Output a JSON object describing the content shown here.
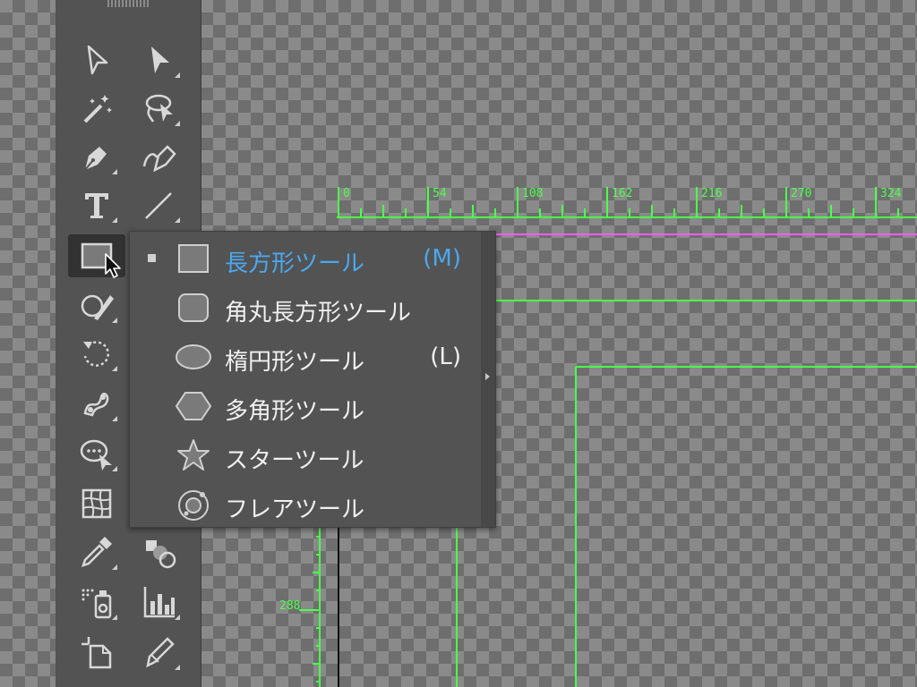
{
  "toolbar": {
    "tools": [
      {
        "name": "selection-tool",
        "icon": "selection-arrow-icon"
      },
      {
        "name": "direct-selection-tool",
        "icon": "direct-selection-arrow-icon"
      },
      {
        "name": "magic-wand-tool",
        "icon": "magic-wand-icon"
      },
      {
        "name": "lasso-tool",
        "icon": "lasso-icon"
      },
      {
        "name": "pen-tool",
        "icon": "pen-icon"
      },
      {
        "name": "curvature-tool",
        "icon": "curvature-pen-icon"
      },
      {
        "name": "type-tool",
        "icon": "type-icon",
        "glyph": "T"
      },
      {
        "name": "line-segment-tool",
        "icon": "line-segment-icon"
      },
      {
        "name": "rectangle-tool",
        "icon": "rectangle-icon",
        "active": true
      },
      {
        "name": "shaper-tool",
        "icon": "shaper-icon"
      },
      {
        "name": "rotate-tool",
        "icon": "rotate-icon"
      },
      {
        "name": "puppet-warp-tool",
        "icon": "puppet-warp-icon"
      },
      {
        "name": "free-transform-tool",
        "icon": "free-transform-icon"
      },
      {
        "name": "perspective-grid-tool",
        "icon": "perspective-grid-icon"
      },
      {
        "name": "eyedropper-tool",
        "icon": "eyedropper-icon"
      },
      {
        "name": "blend-tool",
        "icon": "blend-icon"
      },
      {
        "name": "symbol-sprayer-tool",
        "icon": "symbol-sprayer-icon"
      },
      {
        "name": "column-graph-tool",
        "icon": "column-graph-icon"
      },
      {
        "name": "artboard-tool",
        "icon": "artboard-icon"
      },
      {
        "name": "slice-tool",
        "icon": "slice-knife-icon"
      }
    ]
  },
  "flyout": {
    "items": [
      {
        "label": "長方形ツール",
        "shortcut": "(M)",
        "icon": "rectangle-icon",
        "selected": true
      },
      {
        "label": "角丸長方形ツール",
        "shortcut": "",
        "icon": "rounded-rectangle-icon",
        "selected": false
      },
      {
        "label": "楕円形ツール",
        "shortcut": "(L)",
        "icon": "ellipse-icon",
        "selected": false
      },
      {
        "label": "多角形ツール",
        "shortcut": "",
        "icon": "polygon-icon",
        "selected": false
      },
      {
        "label": "スターツール",
        "shortcut": "",
        "icon": "star-icon",
        "selected": false
      },
      {
        "label": "フレアツール",
        "shortcut": "",
        "icon": "flare-icon",
        "selected": false
      }
    ]
  },
  "ruler": {
    "top_labels": [
      "0",
      "54",
      "108",
      "162",
      "216",
      "270",
      "324"
    ],
    "left_labels": [
      "288"
    ]
  },
  "colors": {
    "guide": "#4cff4c",
    "selection_highlight": "#4aa8f0",
    "margin_line": "#ff5cff",
    "toolbar": "#535353"
  }
}
